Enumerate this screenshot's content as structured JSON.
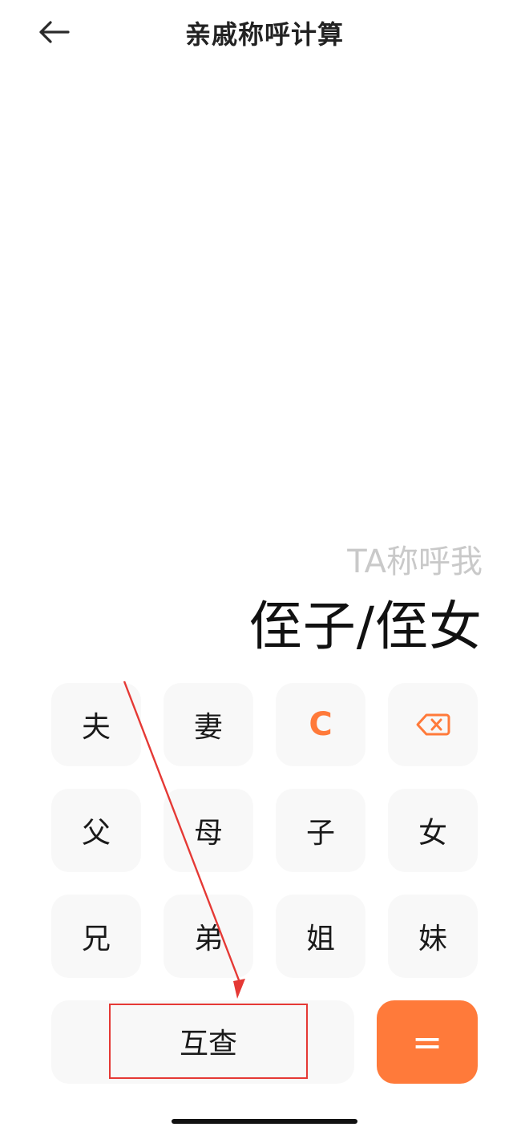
{
  "header": {
    "title": "亲戚称呼计算",
    "back_icon": "arrow-left-icon"
  },
  "result": {
    "label": "TA称呼我",
    "value": "侄子/侄女"
  },
  "keypad": {
    "row1": [
      "夫",
      "妻",
      "C",
      "backspace-icon"
    ],
    "row2": [
      "父",
      "母",
      "子",
      "女"
    ],
    "row3": [
      "兄",
      "弟",
      "姐",
      "妹"
    ],
    "mutual_label": "互查",
    "equals_label": "="
  },
  "colors": {
    "accent": "#ff7a3a",
    "annotation": "#e53935",
    "key_bg": "#f8f8f8"
  }
}
